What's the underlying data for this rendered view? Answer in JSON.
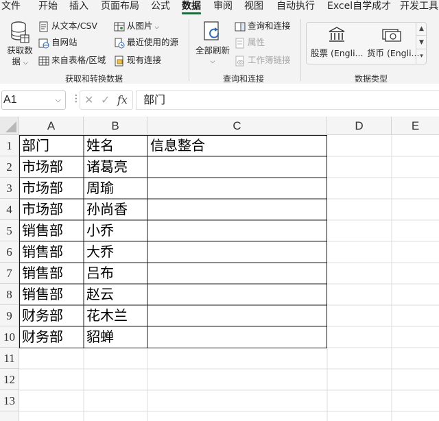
{
  "tabs": [
    {
      "label": "文件"
    },
    {
      "label": "开始"
    },
    {
      "label": "插入"
    },
    {
      "label": "页面布局"
    },
    {
      "label": "公式"
    },
    {
      "label": "数据"
    },
    {
      "label": "审阅"
    },
    {
      "label": "视图"
    },
    {
      "label": "自动执行"
    },
    {
      "label": "Excel自学成才"
    },
    {
      "label": "开发工具"
    }
  ],
  "active_tab": "数据",
  "ribbon": {
    "get_transform": {
      "label": "获取和转换数据",
      "get_data_line1": "获取数",
      "get_data_line2": "据",
      "from_text_csv": "从文本/CSV",
      "from_web": "自网站",
      "from_table_range": "来自表格/区域",
      "from_picture": "从图片",
      "recent_sources": "最近使用的源",
      "existing_connections": "现有连接"
    },
    "queries_connections": {
      "label": "查询和连接",
      "refresh_all": "全部刷新",
      "queries_and_connections": "查询和连接",
      "properties": "属性",
      "edit_links": "工作簿链接"
    },
    "data_types": {
      "label": "数据类型",
      "stocks": "股票 (Engli...",
      "currencies": "货币 (Engli..."
    }
  },
  "formula_bar": {
    "name_box": "A1",
    "formula": "部门"
  },
  "columns": [
    "A",
    "B",
    "C",
    "D",
    "E"
  ],
  "rows": [
    "1",
    "2",
    "3",
    "4",
    "5",
    "6",
    "7",
    "8",
    "9",
    "10",
    "11",
    "12",
    "13"
  ],
  "table": {
    "header": [
      "部门",
      "姓名",
      "信息整合"
    ],
    "rows": [
      [
        "市场部",
        "诸葛亮",
        ""
      ],
      [
        "市场部",
        "周瑜",
        ""
      ],
      [
        "市场部",
        "孙尚香",
        ""
      ],
      [
        "销售部",
        "小乔",
        ""
      ],
      [
        "销售部",
        "大乔",
        ""
      ],
      [
        "销售部",
        "吕布",
        ""
      ],
      [
        "销售部",
        "赵云",
        ""
      ],
      [
        "财务部",
        "花木兰",
        ""
      ],
      [
        "财务部",
        "貂蝉",
        ""
      ]
    ]
  },
  "colors": {
    "accent": "#1e6a3f",
    "ribbon_bg": "#f3f3f3",
    "header_bg": "#f5f5f5",
    "gridline": "#d4d4d4"
  }
}
